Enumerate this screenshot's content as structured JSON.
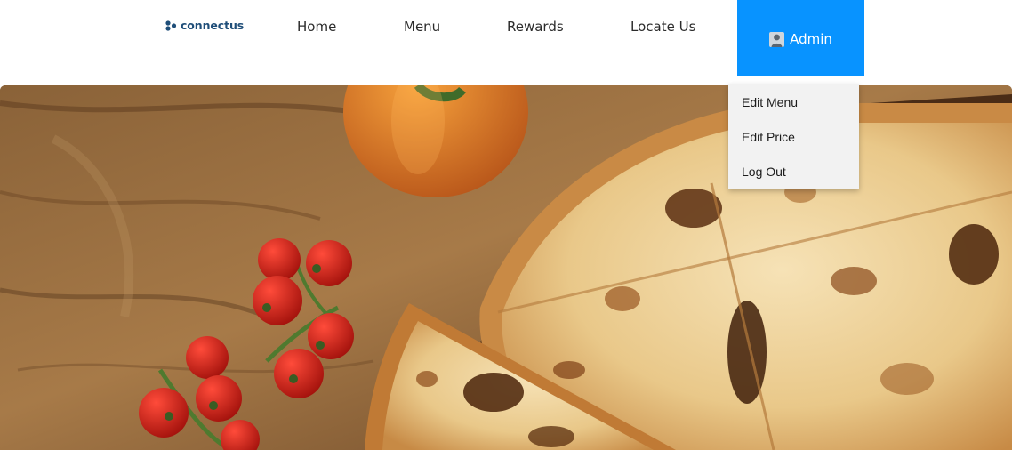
{
  "header": {
    "brand": {
      "name": "connectus",
      "logo_icon": "connectus-logo-icon",
      "color": "#1f4e79"
    },
    "nav": [
      {
        "label": "Home"
      },
      {
        "label": "Menu"
      },
      {
        "label": "Rewards"
      },
      {
        "label": "Locate Us"
      }
    ],
    "admin": {
      "label": "Admin",
      "icon": "user-icon",
      "background": "#0893ff"
    }
  },
  "admin_dropdown": {
    "open": true,
    "items": [
      {
        "label": "Edit Menu"
      },
      {
        "label": "Edit Price"
      },
      {
        "label": "Log Out"
      }
    ]
  },
  "hero": {
    "image": "pizza-on-wooden-table-with-cherry-tomatoes"
  }
}
